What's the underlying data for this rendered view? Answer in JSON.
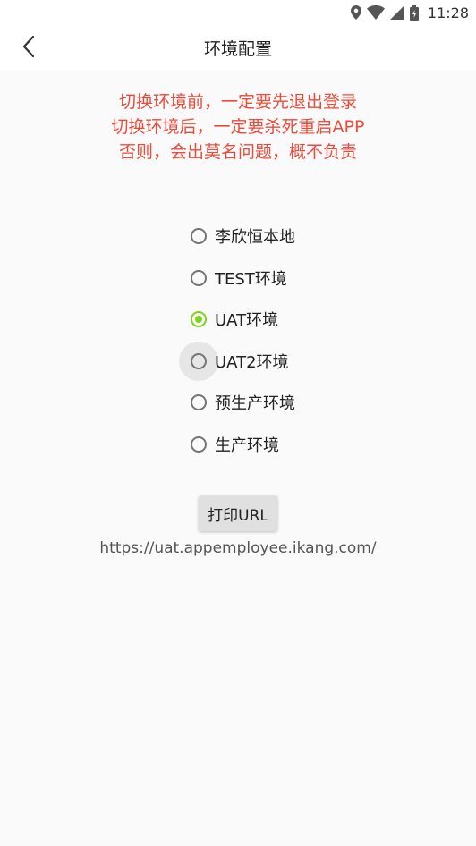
{
  "status_bar": {
    "time": "11:28",
    "icons": [
      "location-icon",
      "wifi-icon",
      "signal-icon",
      "battery-icon"
    ]
  },
  "app_bar": {
    "back_icon": "chevron-left-icon",
    "title": "环境配置"
  },
  "warning": {
    "lines": [
      "切换环境前，一定要先退出登录",
      "切换环境后，一定要杀死重启APP",
      "否则，会出莫名问题，概不负责"
    ],
    "color": "#ec4b3b"
  },
  "environments": [
    {
      "label": "李欣恒本地",
      "selected": false
    },
    {
      "label": "TEST环境",
      "selected": false
    },
    {
      "label": "UAT环境",
      "selected": true
    },
    {
      "label": "UAT2环境",
      "selected": false,
      "pressed": true
    },
    {
      "label": "预生产环境",
      "selected": false
    },
    {
      "label": "生产环境",
      "selected": false
    }
  ],
  "accent_color": "#7ed321",
  "print_button": {
    "label": "打印URL"
  },
  "current_url": "https://uat.appemployee.ikang.com/"
}
